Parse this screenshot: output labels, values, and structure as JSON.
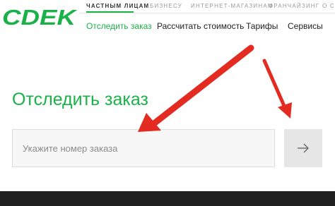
{
  "brand": {
    "logo_text": "CDEK",
    "color": "#1ab248"
  },
  "audience_tabs": [
    {
      "label": "ЧАСТНЫМ ЛИЦАМ",
      "active": true
    },
    {
      "label": "БИЗНЕСУ",
      "active": false
    },
    {
      "label": "ИНТЕРНЕТ-МАГАЗИНАМ",
      "active": false
    },
    {
      "label": "ФРАНЧАЙЗИНГ",
      "active": false
    },
    {
      "label": "О С",
      "active": false
    }
  ],
  "main_nav": [
    {
      "label": "Отследить заказ",
      "active": true
    },
    {
      "label": "Рассчитать стоимость",
      "active": false
    },
    {
      "label": "Тарифы",
      "active": false
    },
    {
      "label": "Сервисы",
      "active": false
    }
  ],
  "tracking": {
    "title": "Отследить заказ",
    "input_placeholder": "Укажите номер заказа",
    "input_value": "",
    "submit_icon": "arrow-right-icon"
  },
  "annotation": {
    "color": "#e32b22",
    "icon": "red-pointer-arrows"
  }
}
